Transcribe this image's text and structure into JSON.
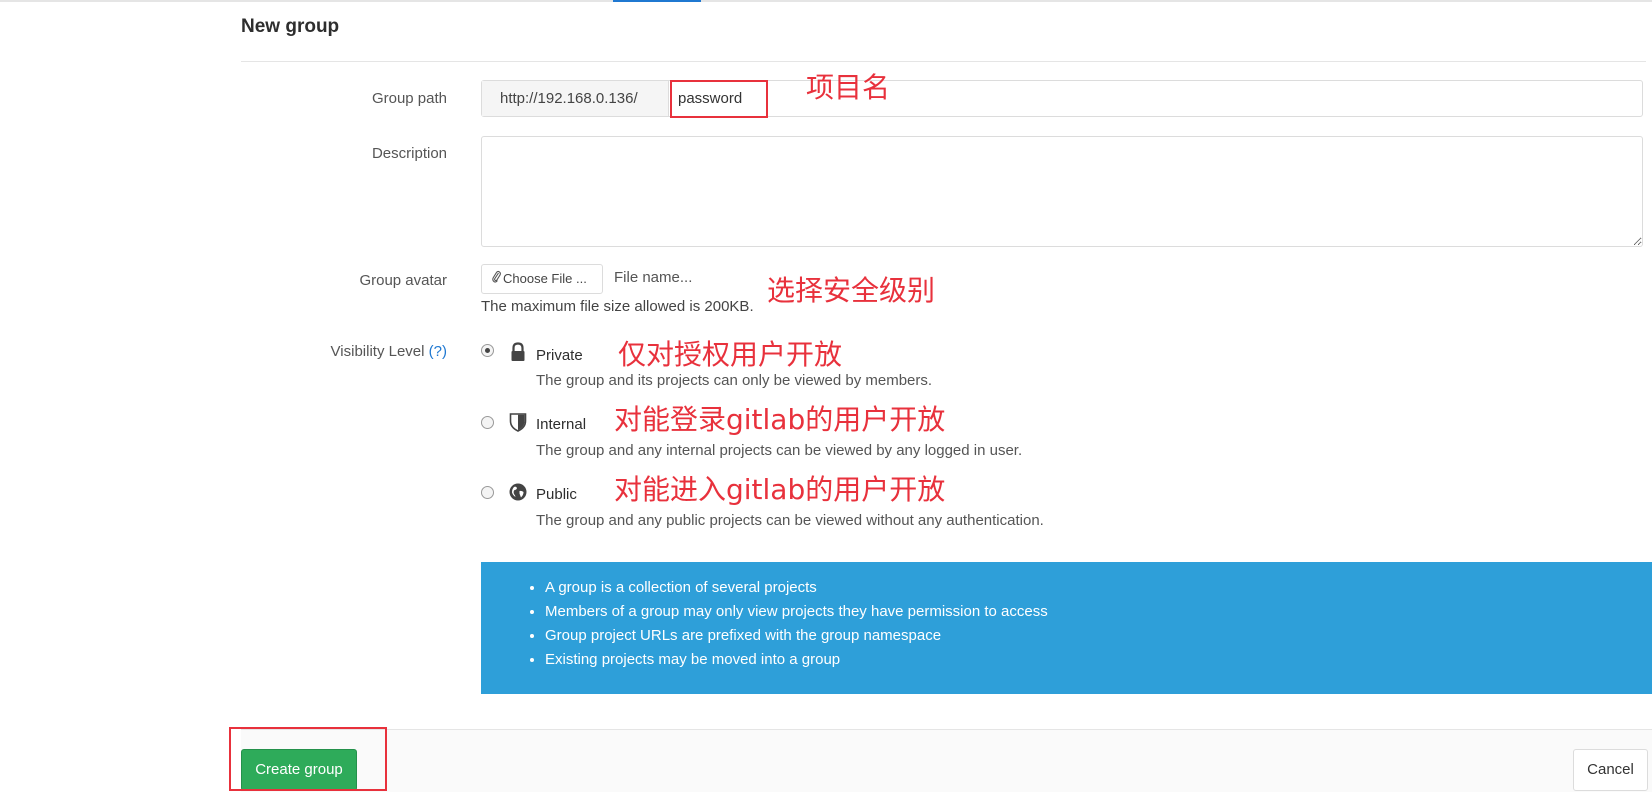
{
  "page": {
    "title": "New group"
  },
  "form": {
    "group_path": {
      "label": "Group path",
      "prefix": "http://192.168.0.136/",
      "value": "password"
    },
    "description": {
      "label": "Description",
      "value": ""
    },
    "avatar": {
      "label": "Group avatar",
      "choose_button": "Choose File ...",
      "file_name": "File name...",
      "help": "The maximum file size allowed is 200KB."
    },
    "visibility": {
      "label": "Visibility Level",
      "help_link": "(?)",
      "options": [
        {
          "title": "Private",
          "description": "The group and its projects can only be viewed by members.",
          "icon": "lock-icon",
          "checked": true
        },
        {
          "title": "Internal",
          "description": "The group and any internal projects can be viewed by any logged in user.",
          "icon": "shield-icon",
          "checked": false
        },
        {
          "title": "Public",
          "description": "The group and any public projects can be viewed without any authentication.",
          "icon": "globe-icon",
          "checked": false
        }
      ]
    }
  },
  "info": {
    "items": [
      "A group is a collection of several projects",
      "Members of a group may only view projects they have permission to access",
      "Group project URLs are prefixed with the group namespace",
      "Existing projects may be moved into a group"
    ]
  },
  "actions": {
    "create_label": "Create group",
    "cancel_label": "Cancel"
  },
  "annotations": {
    "project_name": "项目名",
    "choose_security": "选择安全级别",
    "private_note": "仅对授权用户开放",
    "internal_note": "对能登录gitlab的用户开放",
    "public_note": "对能进入gitlab的用户开放"
  },
  "colors": {
    "accent": "#1f78d1",
    "info_bg": "#2e9fd9",
    "create_btn": "#2eab5a",
    "annotation": "#e8313c"
  }
}
